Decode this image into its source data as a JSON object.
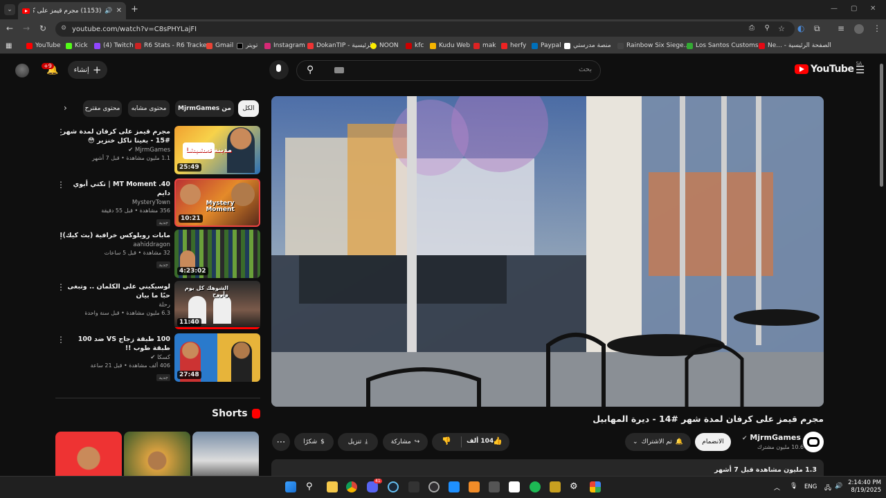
{
  "browser": {
    "tab_title": "(1153) مجرم قيمز على كرفان",
    "url": "youtube.com/watch?v=C8sPHYLajFI",
    "bookmarks": [
      "YouTube",
      "Kick",
      "(4) Twitch",
      "R6 Stats - R6 Tracke...",
      "Gmail",
      "تويتر",
      "Instagram",
      "DokanTIP - الرئيسية",
      "NOON",
      "kfc",
      "Kudu Web",
      "mak",
      "herfy",
      "Paypal",
      "منصة مدرستي",
      "Rainbow Six Siege...",
      "Los Santos Customs...",
      "Ne... - الصفحة الرئيسية"
    ]
  },
  "header": {
    "logo_text": "YouTube",
    "logo_region": "SA",
    "search_placeholder": "بحث",
    "create_label": "إنشاء",
    "notification_count": "+9"
  },
  "chips": [
    "الكل",
    "من MjrmGames",
    "محتوى مشابه",
    "محتوى مقترح"
  ],
  "recommendations": [
    {
      "title": "مجرم قيمز على كرفان لمدة شهر #15 - بغينا ناكل خنزير 😳",
      "channel": "MjrmGames",
      "verified": true,
      "meta": "1.1 مليون مشاهدة • قبل 7 أشهر",
      "duration": "25:49",
      "badge": "",
      "colors": [
        "#f0a030",
        "#2a6fb5",
        "#f7d24a"
      ]
    },
    {
      "title": "MT Moment .40 | تكتي أبوي دايم",
      "channel": "MysteryTown",
      "verified": false,
      "meta": "356 مشاهدة • قبل 55 دقيقة",
      "duration": "10:21",
      "badge": "جديد",
      "colors": [
        "#b33",
        "#e48a2a",
        "#5a2a1a"
      ]
    },
    {
      "title": "مابات روبلوكس خرافية (بث كيك)!",
      "channel": "aahiddragon",
      "verified": false,
      "meta": "32 مشاهدة • قبل 5 ساعات",
      "duration": "4:23:02",
      "badge": "جديد",
      "colors": [
        "#3a6b2a",
        "#1f3b5a",
        "#6aa03a"
      ]
    },
    {
      "title": "لوسيكيني على الكلمان .. وتبغى حبًا ما بيان",
      "channel": "رحلة",
      "verified": false,
      "meta": "6.3 مليون مشاهدة • قبل سنة واحدة",
      "duration": "11:40",
      "badge": "",
      "colors": [
        "#ddd",
        "#7a5a4a",
        "#2a2a2a"
      ]
    },
    {
      "title": "100 طبقة زجاج VS ضد 100 طبقة طوب !!",
      "channel": "كسكا",
      "verified": true,
      "meta": "406 ألف مشاهدة • قبل 21 ساعة",
      "duration": "27:48",
      "badge": "جديد",
      "colors": [
        "#2a7acc",
        "#e7b43a",
        "#c33"
      ]
    }
  ],
  "thumb_texts": [
    "مدينة تعشيشا",
    "Mystery Moment",
    "",
    "الشوهك كل يوم وأروح",
    ""
  ],
  "video": {
    "title": "مجرم قيمز على كرفان لمدة شهر #14 - ديرة المهابيل",
    "channel": "MjrmGames",
    "subscribers": "10.6 مليون مشترك",
    "join_label": "الانضمام",
    "subscribed_label": "تم الاشتراك",
    "likes": "104 ألف",
    "share_label": "مشاركة",
    "download_label": "تنزيل",
    "thanks_label": "شكرًا",
    "views_line": "1.3 مليون مشاهدة قبل 7 أشهر"
  },
  "shorts": {
    "heading": "Shorts"
  },
  "taskbar": {
    "lang": "ENG",
    "time": "2:14:40 PM",
    "date": "8/19/2025",
    "discord_badge": "41"
  },
  "colors": {
    "accent": "#ff0000",
    "bg": "#0f0f0f"
  }
}
